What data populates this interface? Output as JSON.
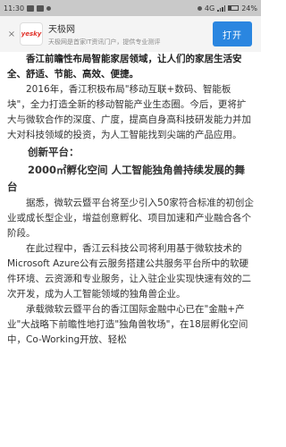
{
  "status_bar": {
    "time": "11:30",
    "network": "4G",
    "battery": "24%"
  },
  "banner": {
    "close": "×",
    "logo_text": "yesky",
    "title": "天极网",
    "subtitle": "天极网是首家IT资讯门户，提供专业测评",
    "open_button": "打开"
  },
  "article": {
    "p1": "香江前瞻性布局智能家居领域，让人们的家居生活安全、舒适、节能、高效、便捷。",
    "p2": "2016年，香江积极布局\"移动互联+数码、智能板块\"，全力打造全新的移动智能产业生态圈。今后，更将扩大与微软合作的深度、广度，提高自身高科技研发能力并加大对科技领域的投资，为人工智能找到尖端的产品应用。",
    "h1": "创新平台：",
    "h2": "2000㎡孵化空间 人工智能独角兽持续发展的舞台",
    "p3": "据悉，微软云暨平台将至少引入50家符合标准的初创企业或成长型企业，增益创意孵化、项目加速和产业融合各个阶段。",
    "p4": "在此过程中，香江云科技公司将利用基于微软技术的Microsoft Azure公有云服务搭建公共服务平台所中的软硬件环境、云资源和专业服务，让入驻企业实现快速有效的二次开发，成为人工智能领域的独角兽企业。",
    "p5": "承载微软云暨平台的香江国际金融中心已在\"金融+产业\"大战略下前瞻性地打造\"独角兽牧场\"，在18层孵化空间中，Co-Working开放、轻松"
  }
}
